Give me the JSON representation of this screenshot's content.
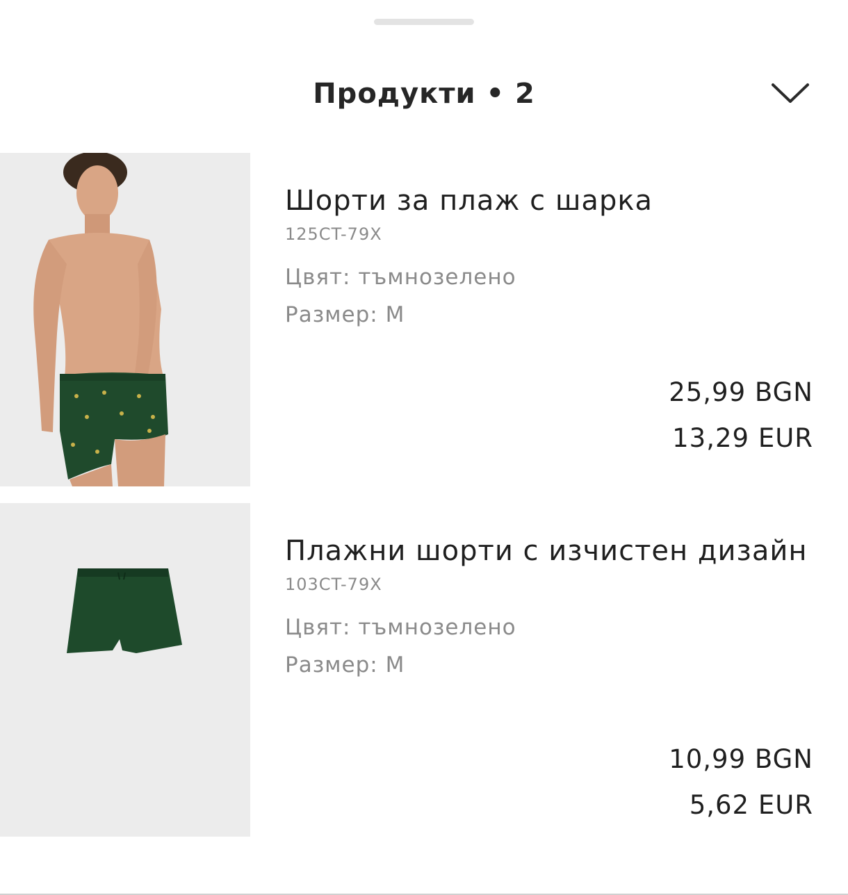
{
  "header": {
    "title": "Продукти • 2",
    "collapse_icon": "chevron-down-icon"
  },
  "products": [
    {
      "name": "Шорти за плаж с шарка",
      "sku": "125CT-79X",
      "color": "Цвят: тъмнозелено",
      "size": "Размер: M",
      "price_bgn": "25,99 BGN",
      "price_eur": "13,29 EUR",
      "image": "model-wearing-patterned-shorts"
    },
    {
      "name": "Плажни шорти с изчистен дизайн",
      "sku": "103CT-79X",
      "color": "Цвят: тъмнозелено",
      "size": "Размер: M",
      "price_bgn": "10,99 BGN",
      "price_eur": "5,62 EUR",
      "image": "plain-shorts-flatlay"
    }
  ],
  "colors": {
    "text": "#1f1f1f",
    "muted": "#8a8a8a",
    "shorts_green": "#1f4a2c",
    "image_bg": "#ececec"
  }
}
